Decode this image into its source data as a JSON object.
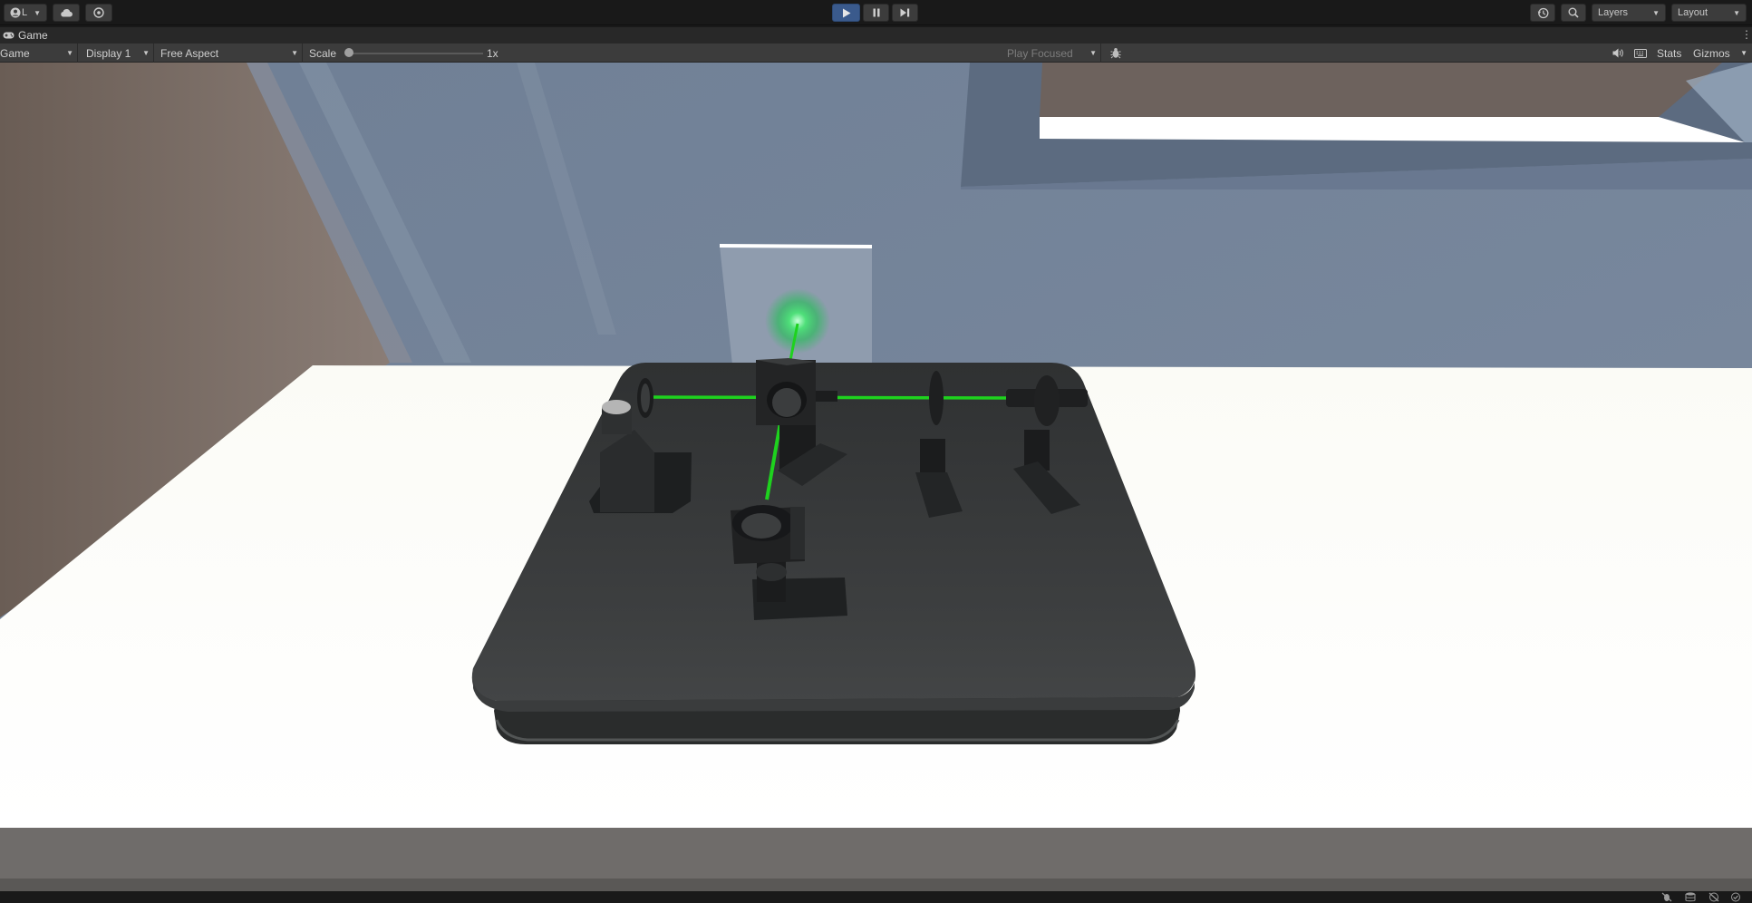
{
  "toolbar": {
    "account_label": "L",
    "cloud_icon": "cloud-icon",
    "collab_icon": "collab-icon",
    "play_icon": "play-icon",
    "pause_icon": "pause-icon",
    "step_icon": "step-icon",
    "history_icon": "history-icon",
    "search_icon": "search-icon",
    "layers_label": "Layers",
    "layout_label": "Layout"
  },
  "tab": {
    "label": "Game",
    "icon": "gamepad-icon"
  },
  "controls": {
    "view_mode": "Game",
    "display": "Display 1",
    "aspect": "Free Aspect",
    "scale_label": "Scale",
    "scale_value": "1x",
    "scale_fraction": 0.0,
    "play_focused": "Play Focused",
    "stats_label": "Stats",
    "gizmos_label": "Gizmos"
  },
  "scene": {
    "laser_color": "#1ed21e",
    "table_color": "#2f3132",
    "screen_color": "#8d9aab",
    "background_color": "#6e7d91"
  },
  "colors": {
    "play_active": "#3a5a8c",
    "toolbar_bg": "#191919",
    "controlbar_bg": "#3c3c3c"
  }
}
